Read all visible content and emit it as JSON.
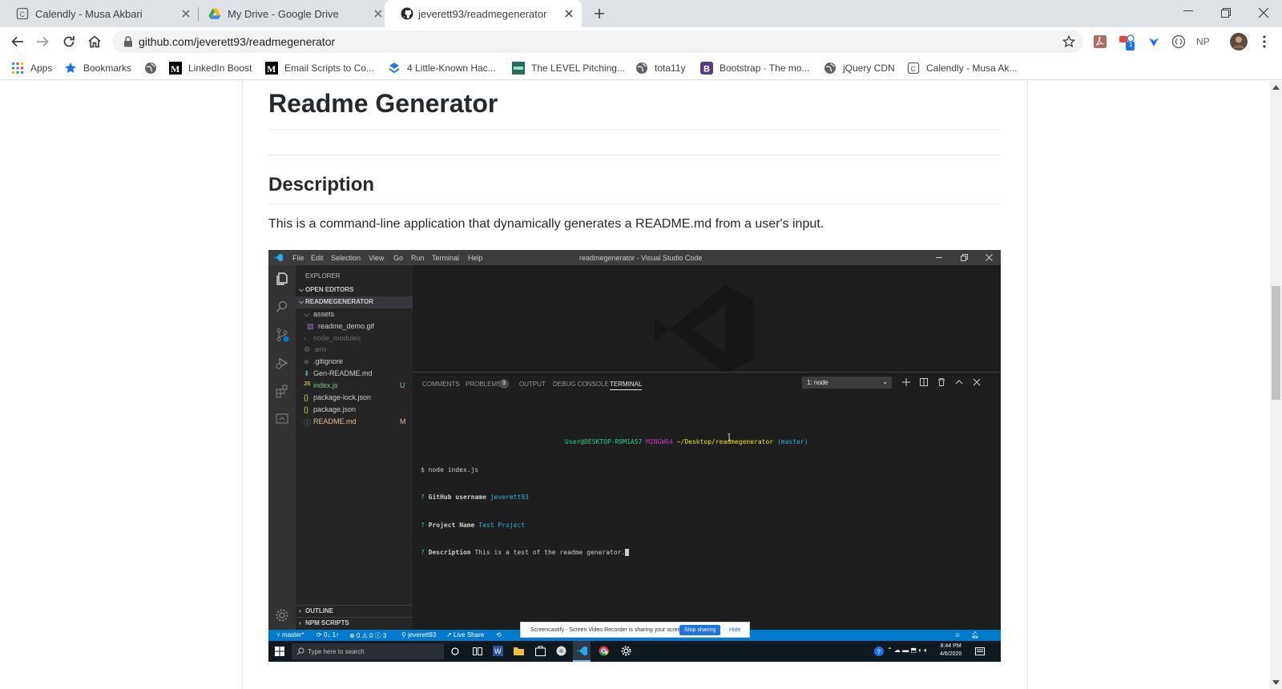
{
  "browser": {
    "tabs": [
      {
        "title": "Calendly - Musa Akbari",
        "icon": "calendly-icon",
        "active": false
      },
      {
        "title": "My Drive - Google Drive",
        "icon": "google-drive-icon",
        "active": false
      },
      {
        "title": "jeverett93/readmegenerator",
        "icon": "github-icon",
        "active": true
      }
    ],
    "url": "github.com/jeverett93/readmegenerator",
    "extension_badge": "1",
    "extension_np": "NP",
    "bookmarks": [
      {
        "label": "Apps",
        "icon": "apps-grid-icon"
      },
      {
        "label": "Bookmarks",
        "icon": "star-icon"
      },
      {
        "label": "",
        "icon": "globe-icon"
      },
      {
        "label": "LinkedIn Boost",
        "icon": "medium-icon"
      },
      {
        "label": "Email Scripts to Co...",
        "icon": "medium-icon"
      },
      {
        "label": "4 Little-Known Hac...",
        "icon": "dropbox-like-icon"
      },
      {
        "label": "The LEVEL Pitching...",
        "icon": "level-icon"
      },
      {
        "label": "tota11y",
        "icon": "globe-icon"
      },
      {
        "label": "Bootstrap · The mo...",
        "icon": "bootstrap-icon"
      },
      {
        "label": "jQuery CDN",
        "icon": "globe-icon"
      },
      {
        "label": "Calendly - Musa Ak...",
        "icon": "calendly-icon"
      }
    ]
  },
  "readme": {
    "title": "Readme Generator",
    "section_heading": "Description",
    "description": "This is a command-line application that dynamically generates a README.md from a user's input."
  },
  "vscode": {
    "menu": [
      "File",
      "Edit",
      "Selection",
      "View",
      "Go",
      "Run",
      "Terminal",
      "Help"
    ],
    "window_title": "readmegenerator - Visual Studio Code",
    "explorer_label": "EXPLORER",
    "open_editors": "OPEN EDITORS",
    "project": "READMEGENERATOR",
    "files": [
      {
        "name": "assets",
        "color": "#cccccc",
        "badge": ""
      },
      {
        "name": "readme_demo.gif",
        "color": "#cccccc",
        "badge": ""
      },
      {
        "name": "node_modules",
        "color": "#6b6b6b",
        "badge": ""
      },
      {
        "name": ".env",
        "color": "#6b6b6b",
        "badge": ""
      },
      {
        "name": ".gitignore",
        "color": "#cccccc",
        "badge": ""
      },
      {
        "name": "Gen-README.md",
        "color": "#cccccc",
        "badge": ""
      },
      {
        "name": "index.js",
        "color": "#73c991",
        "badge": "U"
      },
      {
        "name": "package-lock.json",
        "color": "#cccccc",
        "badge": ""
      },
      {
        "name": "package.json",
        "color": "#cccccc",
        "badge": ""
      },
      {
        "name": "README.md",
        "color": "#e2c08d",
        "badge": "M"
      }
    ],
    "outline": "OUTLINE",
    "npm_scripts": "NPM SCRIPTS",
    "panel_tabs": [
      "COMMENTS",
      "PROBLEMS",
      "OUTPUT",
      "DEBUG CONSOLE",
      "TERMINAL"
    ],
    "problems_count": "3",
    "terminal_select": "1: node",
    "terminal": {
      "prompt_user": "User@DESKTOP-R9M1A57",
      "prompt_env": "MINGW64",
      "prompt_path": "~/Desktop/readmegenerator",
      "prompt_branch": "(master)",
      "command": "$ node index.js",
      "q1_label": "GitHub username",
      "q1_answer": "jeverett93",
      "q2_label": "Project Name",
      "q2_answer": "Test Project",
      "q3_label": "Description",
      "q3_answer": "This is a test of the readme generator."
    },
    "statusbar": {
      "branch": "master*",
      "sync": "0↓ 1↑",
      "problems": "⊗ 0 ⚠ 0 ⓘ 3",
      "user": "jeverett93",
      "live_share": "Live Share"
    },
    "share_banner": {
      "text": "Screencastify - Screen Video Recorder is sharing your screen.",
      "stop": "Stop sharing",
      "hide": "Hide"
    },
    "taskbar": {
      "search_placeholder": "Type here to search",
      "time": "8:44 PM",
      "date": "4/6/2020"
    }
  },
  "colors": {
    "vscode_blue": "#007acc",
    "terminal_green": "#23d18b",
    "terminal_magenta": "#bc3fbc",
    "terminal_yellow": "#e5e510",
    "terminal_cyan": "#29b8db"
  }
}
